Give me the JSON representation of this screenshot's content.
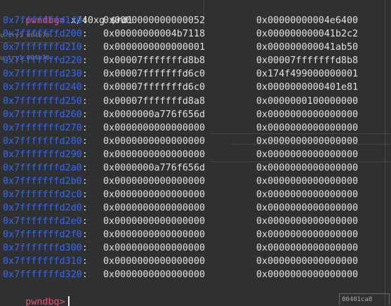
{
  "prompt": "pwndbg>",
  "command": " x/40xg $rdi",
  "rows": [
    {
      "addr": "0x7fffffffd1f0",
      "v1": "0x0000000000000052",
      "v2": "0x00000000004e6400"
    },
    {
      "addr": "0x7fffffffd200",
      "v1": "0x00000000004b7118",
      "v2": "0x000000000041b2c2"
    },
    {
      "addr": "0x7fffffffd210",
      "v1": "0x0000000000000001",
      "v2": "0x000000000041ab50"
    },
    {
      "addr": "0x7fffffffd220",
      "v1": "0x00007fffffffd8b8",
      "v2": "0x00007fffffffd8b8"
    },
    {
      "addr": "0x7fffffffd230",
      "v1": "0x00007fffffffd6c0",
      "v2": "0x174f499000000001"
    },
    {
      "addr": "0x7fffffffd240",
      "v1": "0x00007fffffffd6c0",
      "v2": "0x0000000000401e81"
    },
    {
      "addr": "0x7fffffffd250",
      "v1": "0x00007fffffffd8a8",
      "v2": "0x0000000100000000"
    },
    {
      "addr": "0x7fffffffd260",
      "v1": "0x0000000a776f656d",
      "v2": "0x0000000000000000"
    },
    {
      "addr": "0x7fffffffd270",
      "v1": "0x0000000000000000",
      "v2": "0x0000000000000000"
    },
    {
      "addr": "0x7fffffffd280",
      "v1": "0x0000000000000000",
      "v2": "0x0000000000000000"
    },
    {
      "addr": "0x7fffffffd290",
      "v1": "0x0000000000000000",
      "v2": "0x0000000000000000"
    },
    {
      "addr": "0x7fffffffd2a0",
      "v1": "0x0000000a776f656d",
      "v2": "0x0000000000000000"
    },
    {
      "addr": "0x7fffffffd2b0",
      "v1": "0x0000000000000000",
      "v2": "0x0000000000000000"
    },
    {
      "addr": "0x7fffffffd2c0",
      "v1": "0x0000000000000000",
      "v2": "0x0000000000000000"
    },
    {
      "addr": "0x7fffffffd2d0",
      "v1": "0x0000000000000000",
      "v2": "0x0000000000000000"
    },
    {
      "addr": "0x7fffffffd2e0",
      "v1": "0x0000000000000000",
      "v2": "0x0000000000000000"
    },
    {
      "addr": "0x7fffffffd2f0",
      "v1": "0x0000000000000000",
      "v2": "0x0000000000000000"
    },
    {
      "addr": "0x7fffffffd300",
      "v1": "0x0000000000000000",
      "v2": "0x0000000000000000"
    },
    {
      "addr": "0x7fffffffd310",
      "v1": "0x0000000000000000",
      "v2": "0x0000000000000000"
    },
    {
      "addr": "0x7fffffffd320",
      "v1": "0x0000000000000000",
      "v2": "0x0000000000000000"
    }
  ],
  "final_prompt": "pwndbg>",
  "background_window": {
    "label_1": "u_try1_004b70...",
    "label_2": "u_try1_004b70...",
    "status_text": "00401ca8"
  },
  "colors": {
    "background": "#2e3031",
    "prompt": "#e0546a",
    "address": "#3a62d8",
    "text": "#e2e2e2"
  }
}
